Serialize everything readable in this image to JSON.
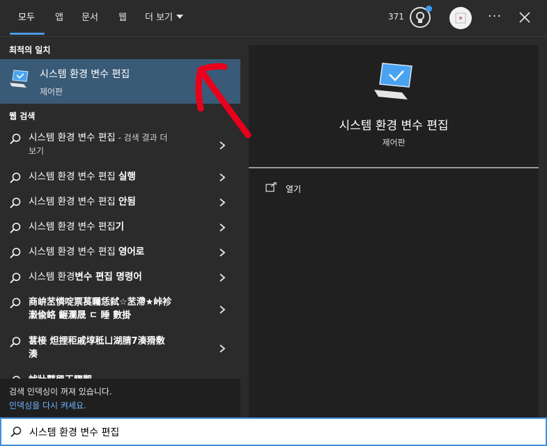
{
  "tabs": [
    {
      "label": "모두",
      "active": true
    },
    {
      "label": "앱"
    },
    {
      "label": "문서"
    },
    {
      "label": "웹"
    },
    {
      "label": "더 보기"
    }
  ],
  "header": {
    "points": "371"
  },
  "best_match": {
    "section": "최적의 일치",
    "title": "시스템 환경 변수 편집",
    "subtitle": "제어판"
  },
  "web_search": {
    "section": "웹 검색",
    "items": [
      {
        "text": "시스템 환경 변수 편집",
        "hint": " - 검색 결과 더",
        "line2": "보기"
      },
      {
        "text": "시스템 환경 변수 편집 ",
        "bold": "실행"
      },
      {
        "text": "시스템 환경 변수 편집 ",
        "bold": "안됨"
      },
      {
        "text": "시스템 환경 변수 편집",
        "bold": "기"
      },
      {
        "text": "시스템 환경 변수 편집 ",
        "bold": "영어로"
      },
      {
        "text": "시스템 환경",
        "bold2": "변수 편집 명령어"
      },
      {
        "text": "商峅苤憐啶票萇矚恁弑☆苤滯★峠袗",
        "line2": "瀫偸峈          齷瀾晟     ㄷ    睡    數掛"
      },
      {
        "text": "葚椄    炟捚秬戚埻秪ㄩ湖腈7湊猾敷",
        "line2": "湊"
      },
      {
        "text": "蚘壯瞽毸王驟觀"
      }
    ]
  },
  "status": {
    "line1": "검색 인덱싱이 꺼져 있습니다.",
    "line2": "인덱싱을 다시 켜세요."
  },
  "detail": {
    "title": "시스템 환경 변수 편집",
    "subtitle": "제어판",
    "action_open": "열기"
  },
  "search": {
    "value": "시스템 환경 변수 편집"
  },
  "colors": {
    "accent": "#3c8fe0",
    "selected": "#3a5b78",
    "annotation": "#e8001c"
  }
}
